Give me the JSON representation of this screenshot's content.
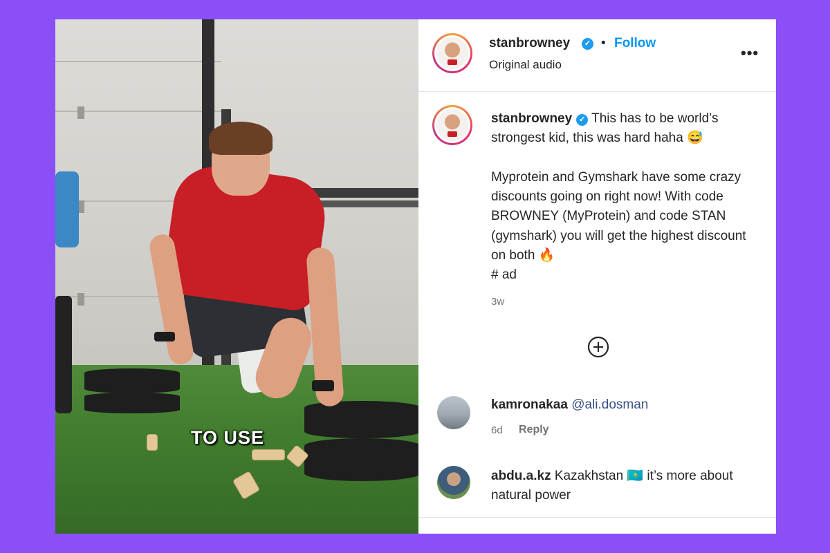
{
  "post": {
    "username": "stanbrowney",
    "follow_label": "Follow",
    "separator": "•",
    "audio_label": "Original audio",
    "more_label": "•••"
  },
  "video": {
    "overlay_text": "TO USE"
  },
  "caption": {
    "username": "stanbrowney",
    "text": " This has to be world’s strongest kid, this was hard haha 😅\n\nMyprotein and Gymshark have some crazy discounts going on right now! With code BROWNEY (MyProtein) and code STAN (gymshark) you will get the highest discount on both 🔥\n# ad",
    "time": "3w"
  },
  "comments": [
    {
      "username": "kamronakaa",
      "mention": "@ali.dosman",
      "text": "",
      "time": "6d",
      "reply_label": "Reply"
    },
    {
      "username": "abdu.a.kz",
      "mention": "",
      "text": " Kazakhstan 🇰🇿 it’s more about natural power",
      "time": "",
      "reply_label": ""
    }
  ],
  "colors": {
    "background": "#8a4ff7",
    "follow_blue": "#0095f6",
    "verified_blue": "#1d9bf0"
  },
  "icons": {
    "verified": "verified-badge-icon",
    "add_comments": "plus-circle-icon",
    "more": "more-horizontal-icon"
  }
}
